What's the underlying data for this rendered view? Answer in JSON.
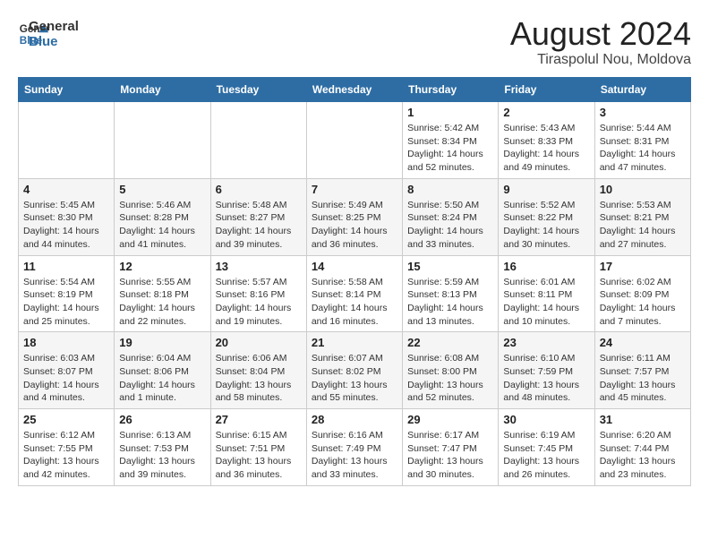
{
  "header": {
    "logo_line1": "General",
    "logo_line2": "Blue",
    "month": "August 2024",
    "location": "Tiraspolul Nou, Moldova"
  },
  "weekdays": [
    "Sunday",
    "Monday",
    "Tuesday",
    "Wednesday",
    "Thursday",
    "Friday",
    "Saturday"
  ],
  "weeks": [
    [
      {
        "day": "",
        "info": ""
      },
      {
        "day": "",
        "info": ""
      },
      {
        "day": "",
        "info": ""
      },
      {
        "day": "",
        "info": ""
      },
      {
        "day": "1",
        "info": "Sunrise: 5:42 AM\nSunset: 8:34 PM\nDaylight: 14 hours and 52 minutes."
      },
      {
        "day": "2",
        "info": "Sunrise: 5:43 AM\nSunset: 8:33 PM\nDaylight: 14 hours and 49 minutes."
      },
      {
        "day": "3",
        "info": "Sunrise: 5:44 AM\nSunset: 8:31 PM\nDaylight: 14 hours and 47 minutes."
      }
    ],
    [
      {
        "day": "4",
        "info": "Sunrise: 5:45 AM\nSunset: 8:30 PM\nDaylight: 14 hours and 44 minutes."
      },
      {
        "day": "5",
        "info": "Sunrise: 5:46 AM\nSunset: 8:28 PM\nDaylight: 14 hours and 41 minutes."
      },
      {
        "day": "6",
        "info": "Sunrise: 5:48 AM\nSunset: 8:27 PM\nDaylight: 14 hours and 39 minutes."
      },
      {
        "day": "7",
        "info": "Sunrise: 5:49 AM\nSunset: 8:25 PM\nDaylight: 14 hours and 36 minutes."
      },
      {
        "day": "8",
        "info": "Sunrise: 5:50 AM\nSunset: 8:24 PM\nDaylight: 14 hours and 33 minutes."
      },
      {
        "day": "9",
        "info": "Sunrise: 5:52 AM\nSunset: 8:22 PM\nDaylight: 14 hours and 30 minutes."
      },
      {
        "day": "10",
        "info": "Sunrise: 5:53 AM\nSunset: 8:21 PM\nDaylight: 14 hours and 27 minutes."
      }
    ],
    [
      {
        "day": "11",
        "info": "Sunrise: 5:54 AM\nSunset: 8:19 PM\nDaylight: 14 hours and 25 minutes."
      },
      {
        "day": "12",
        "info": "Sunrise: 5:55 AM\nSunset: 8:18 PM\nDaylight: 14 hours and 22 minutes."
      },
      {
        "day": "13",
        "info": "Sunrise: 5:57 AM\nSunset: 8:16 PM\nDaylight: 14 hours and 19 minutes."
      },
      {
        "day": "14",
        "info": "Sunrise: 5:58 AM\nSunset: 8:14 PM\nDaylight: 14 hours and 16 minutes."
      },
      {
        "day": "15",
        "info": "Sunrise: 5:59 AM\nSunset: 8:13 PM\nDaylight: 14 hours and 13 minutes."
      },
      {
        "day": "16",
        "info": "Sunrise: 6:01 AM\nSunset: 8:11 PM\nDaylight: 14 hours and 10 minutes."
      },
      {
        "day": "17",
        "info": "Sunrise: 6:02 AM\nSunset: 8:09 PM\nDaylight: 14 hours and 7 minutes."
      }
    ],
    [
      {
        "day": "18",
        "info": "Sunrise: 6:03 AM\nSunset: 8:07 PM\nDaylight: 14 hours and 4 minutes."
      },
      {
        "day": "19",
        "info": "Sunrise: 6:04 AM\nSunset: 8:06 PM\nDaylight: 14 hours and 1 minute."
      },
      {
        "day": "20",
        "info": "Sunrise: 6:06 AM\nSunset: 8:04 PM\nDaylight: 13 hours and 58 minutes."
      },
      {
        "day": "21",
        "info": "Sunrise: 6:07 AM\nSunset: 8:02 PM\nDaylight: 13 hours and 55 minutes."
      },
      {
        "day": "22",
        "info": "Sunrise: 6:08 AM\nSunset: 8:00 PM\nDaylight: 13 hours and 52 minutes."
      },
      {
        "day": "23",
        "info": "Sunrise: 6:10 AM\nSunset: 7:59 PM\nDaylight: 13 hours and 48 minutes."
      },
      {
        "day": "24",
        "info": "Sunrise: 6:11 AM\nSunset: 7:57 PM\nDaylight: 13 hours and 45 minutes."
      }
    ],
    [
      {
        "day": "25",
        "info": "Sunrise: 6:12 AM\nSunset: 7:55 PM\nDaylight: 13 hours and 42 minutes."
      },
      {
        "day": "26",
        "info": "Sunrise: 6:13 AM\nSunset: 7:53 PM\nDaylight: 13 hours and 39 minutes."
      },
      {
        "day": "27",
        "info": "Sunrise: 6:15 AM\nSunset: 7:51 PM\nDaylight: 13 hours and 36 minutes."
      },
      {
        "day": "28",
        "info": "Sunrise: 6:16 AM\nSunset: 7:49 PM\nDaylight: 13 hours and 33 minutes."
      },
      {
        "day": "29",
        "info": "Sunrise: 6:17 AM\nSunset: 7:47 PM\nDaylight: 13 hours and 30 minutes."
      },
      {
        "day": "30",
        "info": "Sunrise: 6:19 AM\nSunset: 7:45 PM\nDaylight: 13 hours and 26 minutes."
      },
      {
        "day": "31",
        "info": "Sunrise: 6:20 AM\nSunset: 7:44 PM\nDaylight: 13 hours and 23 minutes."
      }
    ]
  ]
}
